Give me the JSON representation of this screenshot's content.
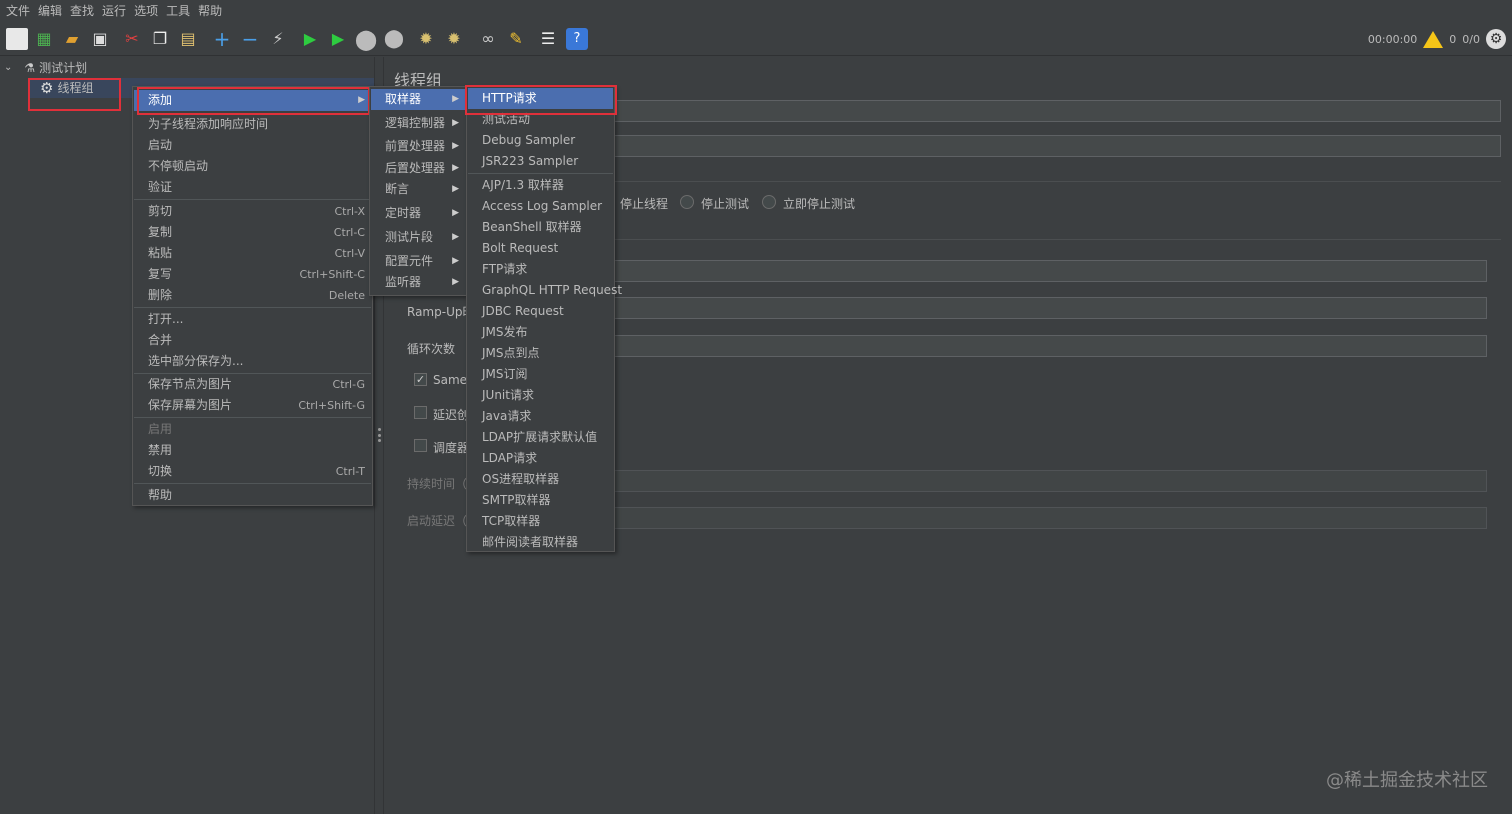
{
  "menubar": [
    "文件",
    "编辑",
    "查找",
    "运行",
    "选项",
    "工具",
    "帮助"
  ],
  "toolbar": {
    "timer": "00:00:00",
    "warnings": "0",
    "threads": "0/0"
  },
  "tree": {
    "root": "测试计划",
    "child": "线程组"
  },
  "context_menu": [
    {
      "label": "添加",
      "shortcut": "",
      "submenu": true,
      "selected": true,
      "disabled": false
    },
    {
      "label": "为子线程添加响应时间",
      "shortcut": "",
      "submenu": false
    },
    {
      "label": "启动",
      "shortcut": ""
    },
    {
      "label": "不停顿启动",
      "shortcut": ""
    },
    {
      "label": "验证",
      "shortcut": ""
    },
    {
      "label": "剪切",
      "shortcut": "Ctrl-X"
    },
    {
      "label": "复制",
      "shortcut": "Ctrl-C"
    },
    {
      "label": "粘贴",
      "shortcut": "Ctrl-V"
    },
    {
      "label": "复写",
      "shortcut": "Ctrl+Shift-C"
    },
    {
      "label": "删除",
      "shortcut": "Delete"
    },
    {
      "label": "打开...",
      "shortcut": ""
    },
    {
      "label": "合并",
      "shortcut": ""
    },
    {
      "label": "选中部分保存为...",
      "shortcut": ""
    },
    {
      "label": "保存节点为图片",
      "shortcut": "Ctrl-G"
    },
    {
      "label": "保存屏幕为图片",
      "shortcut": "Ctrl+Shift-G"
    },
    {
      "label": "启用",
      "shortcut": "",
      "disabled": true
    },
    {
      "label": "禁用",
      "shortcut": ""
    },
    {
      "label": "切换",
      "shortcut": "Ctrl-T"
    },
    {
      "label": "帮助",
      "shortcut": ""
    }
  ],
  "add_submenu": [
    "取样器",
    "逻辑控制器",
    "前置处理器",
    "后置处理器",
    "断言",
    "定时器",
    "测试片段",
    "配置元件",
    "监听器"
  ],
  "sampler_submenu": [
    "HTTP请求",
    "测试活动",
    "Debug Sampler",
    "JSR223 Sampler",
    "AJP/1.3 取样器",
    "Access Log Sampler",
    "BeanShell 取样器",
    "Bolt Request",
    "FTP请求",
    "GraphQL HTTP Request",
    "JDBC Request",
    "JMS发布",
    "JMS点到点",
    "JMS订阅",
    "JUnit请求",
    "Java请求",
    "LDAP扩展请求默认值",
    "LDAP请求",
    "OS进程取样器",
    "SMTP取样器",
    "TCP取样器",
    "邮件阅读者取样器"
  ],
  "right_panel": {
    "title": "线程组",
    "radio_stop_thread": "停止线程",
    "radio_stop_test": "停止测试",
    "radio_stop_now": "立即停止测试",
    "ramp_up": "Ramp-Up时",
    "loop": "循环次数",
    "same_user": "Same",
    "delay": "延迟创",
    "scheduler": "调度器",
    "duration": "持续时间（",
    "startup_delay": "启动延迟（"
  },
  "watermark": "@稀土掘金技术社区"
}
